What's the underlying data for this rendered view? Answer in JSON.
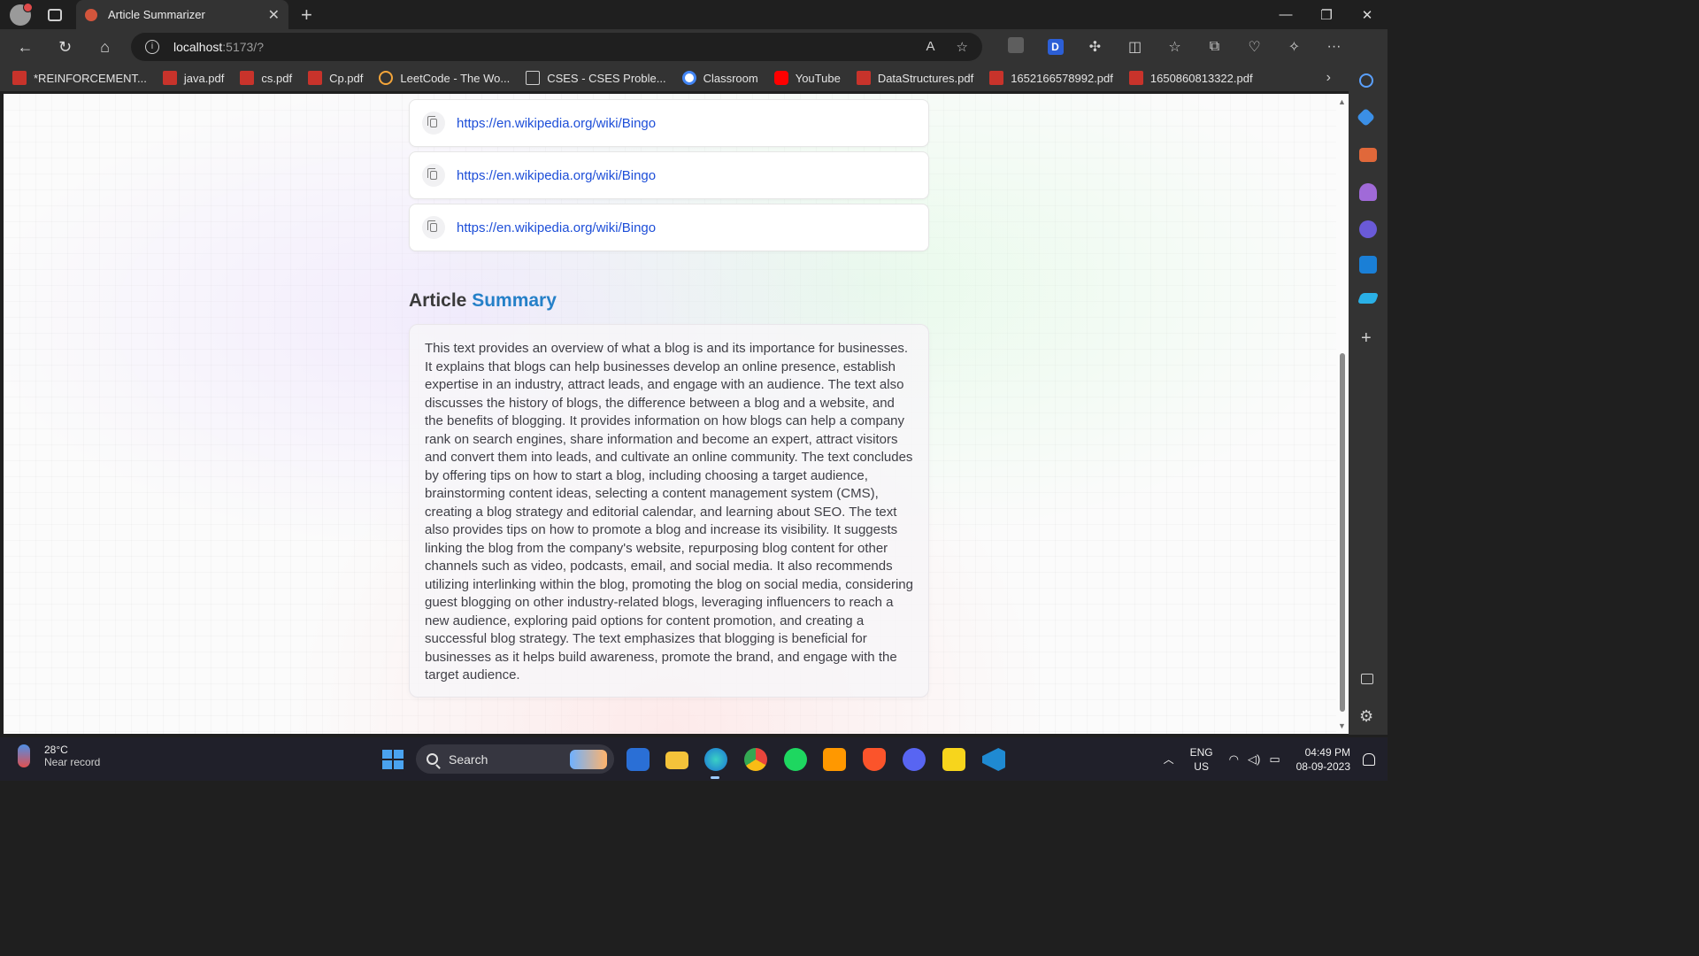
{
  "browser": {
    "tab_title": "Article Summarizer",
    "url_host": "localhost",
    "url_path": ":5173/?",
    "bookmarks": [
      {
        "label": "*REINFORCEMENT...",
        "icon": "pdf-icon"
      },
      {
        "label": "java.pdf",
        "icon": "pdf-icon"
      },
      {
        "label": "cs.pdf",
        "icon": "pdf-icon"
      },
      {
        "label": "Cp.pdf",
        "icon": "pdf-icon"
      },
      {
        "label": "LeetCode - The Wo...",
        "icon": "leetcode-icon"
      },
      {
        "label": "CSES - CSES Proble...",
        "icon": "document-icon"
      },
      {
        "label": "Classroom",
        "icon": "google-icon"
      },
      {
        "label": "YouTube",
        "icon": "youtube-icon"
      },
      {
        "label": "DataStructures.pdf",
        "icon": "pdf-icon"
      },
      {
        "label": "1652166578992.pdf",
        "icon": "pdf-icon"
      },
      {
        "label": "1650860813322.pdf",
        "icon": "pdf-icon"
      }
    ]
  },
  "history": {
    "links": [
      "https://en.wikipedia.org/wiki/Bingo",
      "https://en.wikipedia.org/wiki/Bingo",
      "https://en.wikipedia.org/wiki/Bingo"
    ]
  },
  "summary": {
    "title_prefix": "Article",
    "title_accent": "Summary",
    "text": "This text provides an overview of what a blog is and its importance for businesses. It explains that blogs can help businesses develop an online presence, establish expertise in an industry, attract leads, and engage with an audience. The text also discusses the history of blogs, the difference between a blog and a website, and the benefits of blogging. It provides information on how blogs can help a company rank on search engines, share information and become an expert, attract visitors and convert them into leads, and cultivate an online community. The text concludes by offering tips on how to start a blog, including choosing a target audience, brainstorming content ideas, selecting a content management system (CMS), creating a blog strategy and editorial calendar, and learning about SEO. The text also provides tips on how to promote a blog and increase its visibility. It suggests linking the blog from the company's website, repurposing blog content for other channels such as video, podcasts, email, and social media. It also recommends utilizing interlinking within the blog, promoting the blog on social media, considering guest blogging on other industry-related blogs, leveraging influencers to reach a new audience, exploring paid options for content promotion, and creating a successful blog strategy. The text emphasizes that blogging is beneficial for businesses as it helps build awareness, promote the brand, and engage with the target audience."
  },
  "taskbar": {
    "temperature": "28°C",
    "weather": "Near record",
    "search_label": "Search",
    "lang_top": "ENG",
    "lang_bottom": "US",
    "time": "04:49 PM",
    "date": "08-09-2023"
  },
  "colors": {
    "accent": "#2580c8",
    "link": "#1d4ed8"
  }
}
